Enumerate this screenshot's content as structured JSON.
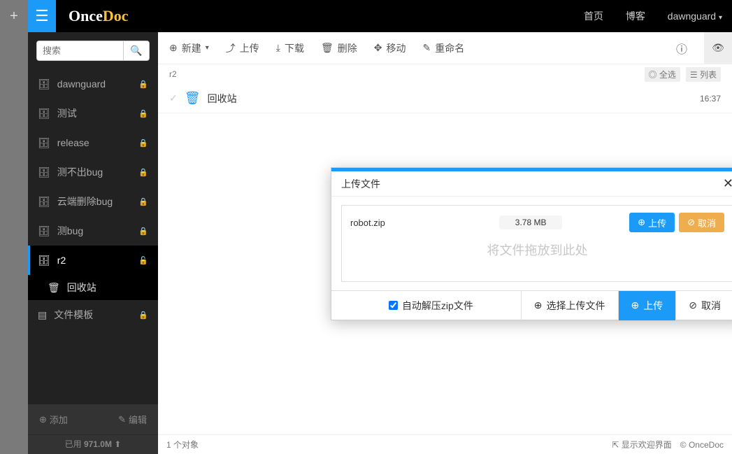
{
  "logo": {
    "a": "Once",
    "b": "Doc"
  },
  "topnav": {
    "home": "首页",
    "blog": "博客",
    "user": "dawnguard"
  },
  "search": {
    "placeholder": "搜索"
  },
  "sidebar": {
    "items": [
      {
        "label": "dawnguard",
        "locked": true
      },
      {
        "label": "测试",
        "locked": true
      },
      {
        "label": "release",
        "locked": true
      },
      {
        "label": "测不出bug",
        "locked": true
      },
      {
        "label": "云端删除bug",
        "locked": true
      },
      {
        "label": "测bug",
        "locked": true
      },
      {
        "label": "r2",
        "locked": false,
        "active": true
      },
      {
        "label": "文件模板",
        "locked": true,
        "icon": "doc"
      }
    ],
    "subitems": [
      {
        "label": "回收站"
      }
    ],
    "footer": {
      "add": "添加",
      "edit": "编辑",
      "usage_prefix": "已用 ",
      "usage_value": "971.0M"
    }
  },
  "toolbar": {
    "new": "新建",
    "upload": "上传",
    "download": "下载",
    "delete": "删除",
    "move": "移动",
    "rename": "重命名"
  },
  "breadcrumb": {
    "path": "r2",
    "select_all": "全选",
    "view_list": "列表"
  },
  "files": {
    "recycle_name": "回收站",
    "recycle_time": "16:37"
  },
  "status": {
    "count": "1 个对象",
    "welcome": "显示欢迎界面",
    "copyright": "© OnceDoc"
  },
  "modal": {
    "title": "上传文件",
    "file": {
      "name": "robot.zip",
      "size": "3.78 MB"
    },
    "btn_upload": "上传",
    "btn_cancel": "取消",
    "drop_hint": "将文件拖放到此处",
    "auto_unzip": "自动解压zip文件",
    "select_file": "选择上传文件",
    "footer_upload": "上传",
    "footer_cancel": "取消"
  }
}
